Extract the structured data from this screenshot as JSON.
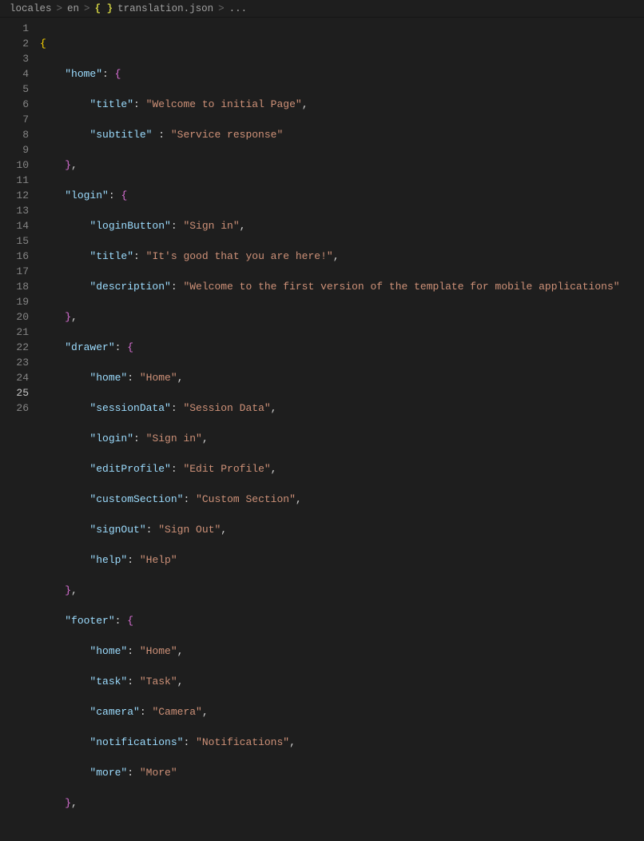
{
  "breadcrumbs": {
    "seg1": "locales",
    "seg2": "en",
    "fileIcon": "{ }",
    "file": "translation.json",
    "ellipsis": "..."
  },
  "sep": ">",
  "lineNumbers": [
    "1",
    "2",
    "3",
    "4",
    "5",
    "6",
    "7",
    "8",
    "9",
    "10",
    "11",
    "12",
    "13",
    "14",
    "15",
    "16",
    "17",
    "18",
    "19",
    "20",
    "21",
    "22",
    "23",
    "24",
    "25",
    "26"
  ],
  "activeLine": 25,
  "json": {
    "home": {
      "titleKey": "\"title\"",
      "titleVal": "\"Welcome to initial Page\"",
      "subtitleKey": "\"subtitle\"",
      "subtitleVal": "\"Service response\""
    },
    "homeKey": "\"home\"",
    "login": {
      "loginButtonKey": "\"loginButton\"",
      "loginButtonVal": "\"Sign in\"",
      "titleKey": "\"title\"",
      "titleVal": "\"It's good that you are here!\"",
      "descriptionKey": "\"description\"",
      "descriptionVal": "\"Welcome to the first version of the template for mobile applications\""
    },
    "loginKey": "\"login\"",
    "drawer": {
      "homeKey": "\"home\"",
      "homeVal": "\"Home\"",
      "sessionDataKey": "\"sessionData\"",
      "sessionDataVal": "\"Session Data\"",
      "loginKey": "\"login\"",
      "loginVal": "\"Sign in\"",
      "editProfileKey": "\"editProfile\"",
      "editProfileVal": "\"Edit Profile\"",
      "customSectionKey": "\"customSection\"",
      "customSectionVal": "\"Custom Section\"",
      "signOutKey": "\"signOut\"",
      "signOutVal": "\"Sign Out\"",
      "helpKey": "\"help\"",
      "helpVal": "\"Help\""
    },
    "drawerKey": "\"drawer\"",
    "footer": {
      "homeKey": "\"home\"",
      "homeVal": "\"Home\"",
      "taskKey": "\"task\"",
      "taskVal": "\"Task\"",
      "cameraKey": "\"camera\"",
      "cameraVal": "\"Camera\"",
      "notificationsKey": "\"notifications\"",
      "notificationsVal": "\"Notifications\"",
      "moreKey": "\"more\"",
      "moreVal": "\"More\""
    },
    "footerKey": "\"footer\""
  }
}
